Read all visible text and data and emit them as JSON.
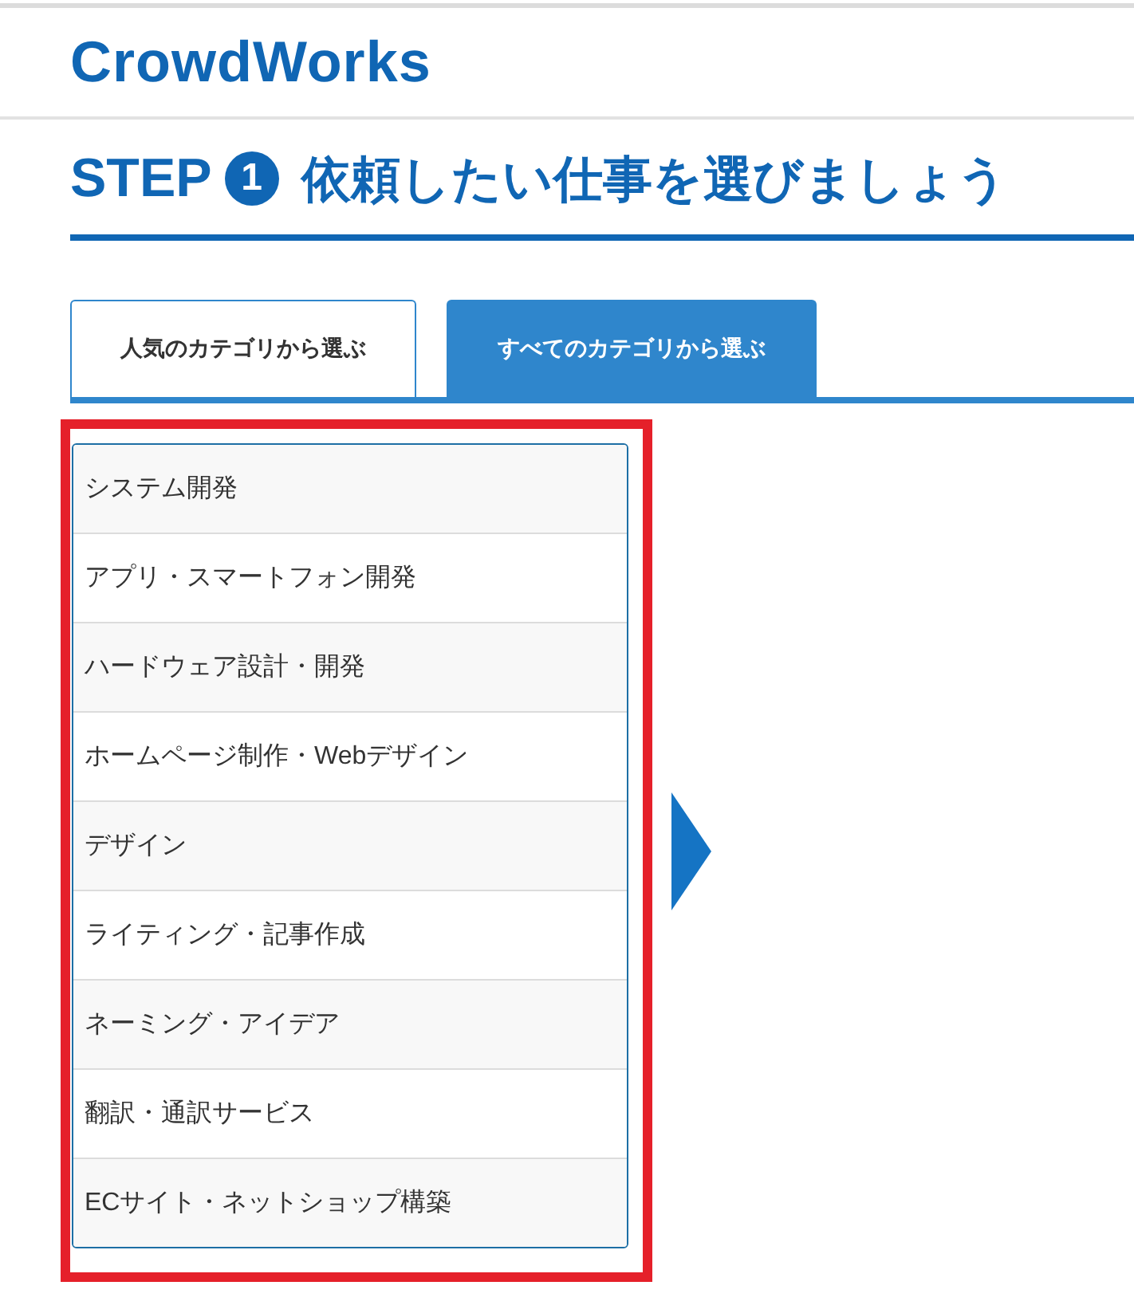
{
  "header": {
    "logo": "CrowdWorks"
  },
  "heading": {
    "step": "STEP",
    "number": "1",
    "title": "依頼したい仕事を選びましょう"
  },
  "tabs": [
    {
      "label": "人気のカテゴリから選ぶ",
      "selected": false
    },
    {
      "label": "すべてのカテゴリから選ぶ",
      "selected": true
    }
  ],
  "category_list": {
    "highlighted": true,
    "items": [
      {
        "label": "システム開発"
      },
      {
        "label": "アプリ・スマートフォン開発"
      },
      {
        "label": "ハードウェア設計・開発"
      },
      {
        "label": "ホームページ制作・Webデザイン"
      },
      {
        "label": "デザイン"
      },
      {
        "label": "ライティング・記事作成"
      },
      {
        "label": "ネーミング・アイデア"
      },
      {
        "label": "翻訳・通訳サービス"
      },
      {
        "label": "ECサイト・ネットショップ構築"
      }
    ]
  }
}
